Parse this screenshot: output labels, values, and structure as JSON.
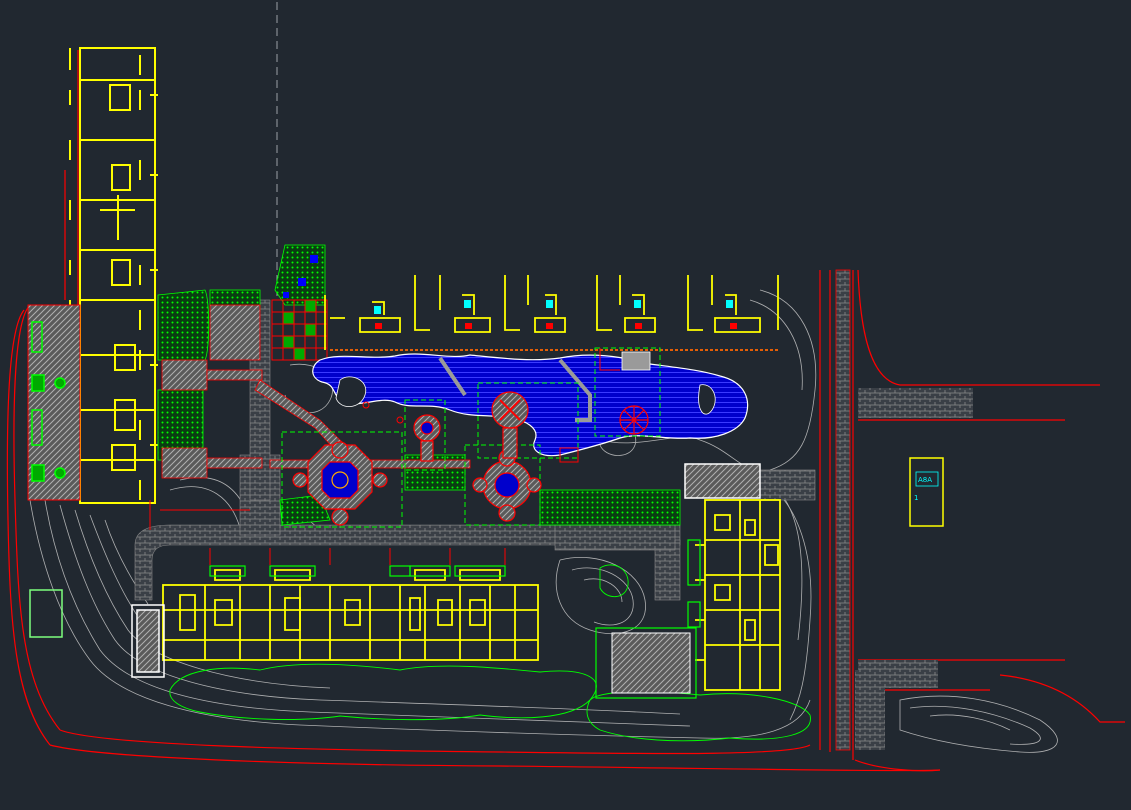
{
  "colors": {
    "background": "#212830",
    "building": "#ffff00",
    "road": "#ff0000",
    "contour": "#c8c8c8",
    "vegetation": "#00ff00",
    "water": "#0000cc",
    "paving": "#9a9a9a",
    "label": "#00ffff",
    "outline": "#ffffff"
  },
  "annotations": {
    "building_tag_line1": "A8A",
    "building_tag_line2": "1"
  }
}
